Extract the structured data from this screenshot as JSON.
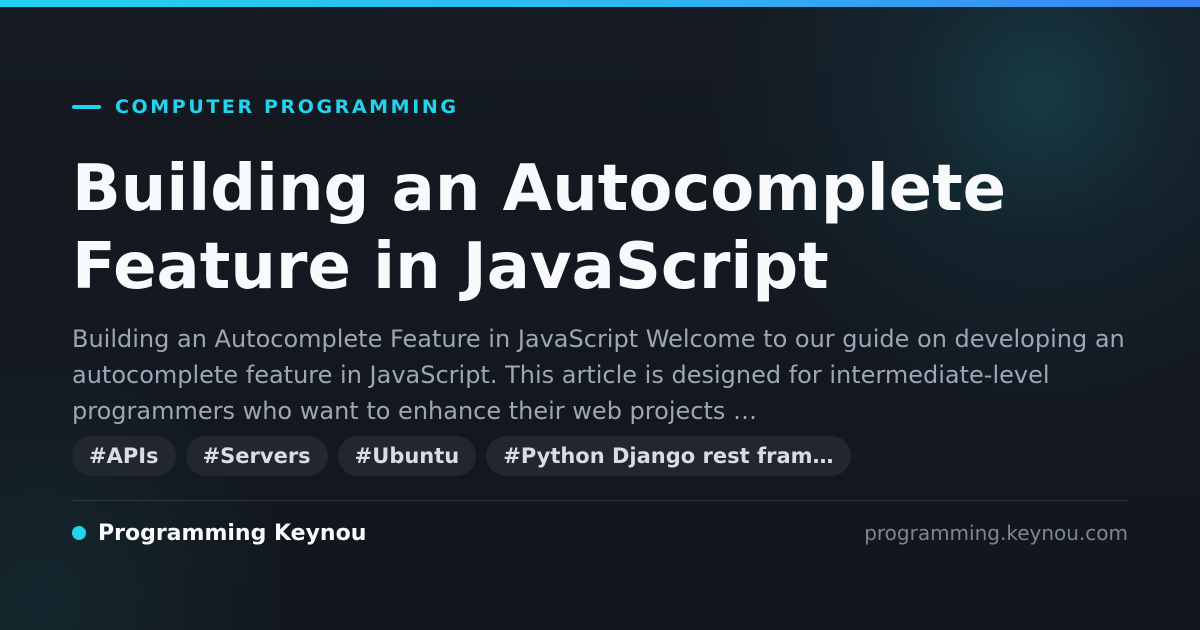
{
  "colors": {
    "accent": "#22d3ee",
    "accent_end": "#3b82f6",
    "background": "#13171f",
    "title": "#f8fafc",
    "description": "#9ca6b5",
    "tag_background": "#212631",
    "tag_text": "#d7dde6",
    "domain": "#7d8694"
  },
  "category": "COMPUTER PROGRAMMING",
  "title": "Building an Autocomplete Feature in JavaScript",
  "description": "Building an Autocomplete Feature in JavaScript Welcome to our guide on developing an autocomplete feature in JavaScript. This article is designed for intermediate-level programmers who want to enhance their web projects …",
  "tags": [
    {
      "label": "#APIs"
    },
    {
      "label": "#Servers"
    },
    {
      "label": "#Ubuntu"
    },
    {
      "label": "#Python Django rest fram…"
    }
  ],
  "footer": {
    "site_name": "Programming Keynou",
    "domain": "programming.keynou.com"
  }
}
